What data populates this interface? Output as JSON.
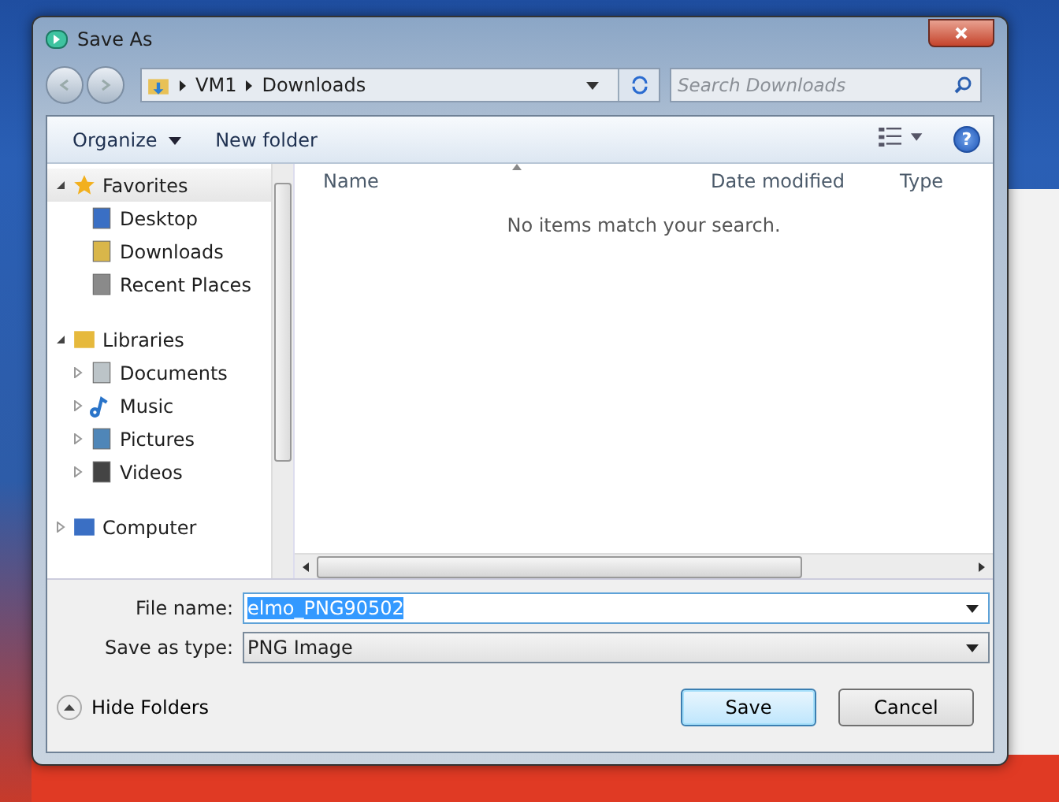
{
  "window": {
    "title": "Save As"
  },
  "address": {
    "path": [
      {
        "label": "VM1"
      },
      {
        "label": "Downloads"
      }
    ]
  },
  "search": {
    "placeholder": "Search Downloads"
  },
  "toolbar": {
    "organize": "Organize",
    "new_folder": "New folder",
    "help": "?"
  },
  "nav_tree": [
    {
      "label": "Favorites",
      "selected": true,
      "expanded": true,
      "children": [
        {
          "label": "Desktop",
          "selected": false
        },
        {
          "label": "Downloads",
          "selected": false
        },
        {
          "label": "Recent Places",
          "selected": false
        }
      ]
    },
    {
      "label": "Libraries",
      "selected": false,
      "expanded": true,
      "children": [
        {
          "label": "Documents",
          "selected": false,
          "expanded": false
        },
        {
          "label": "Music",
          "selected": false,
          "expanded": false
        },
        {
          "label": "Pictures",
          "selected": false,
          "expanded": false
        },
        {
          "label": "Videos",
          "selected": false,
          "expanded": false
        }
      ]
    },
    {
      "label": "Computer",
      "selected": false,
      "expanded": false
    }
  ],
  "file_list": {
    "columns": [
      "Name",
      "Date modified",
      "Type"
    ],
    "empty_message": "No items match your search."
  },
  "form": {
    "file_name_label": "File name:",
    "file_name": "elmo_PNG90502",
    "file_name_selected": true,
    "type_label": "Save as type:",
    "type": "PNG Image"
  },
  "hide_folders": "Hide Folders",
  "buttons": [
    {
      "label": "Save",
      "default": true
    },
    {
      "label": "Cancel",
      "default": false
    }
  ]
}
